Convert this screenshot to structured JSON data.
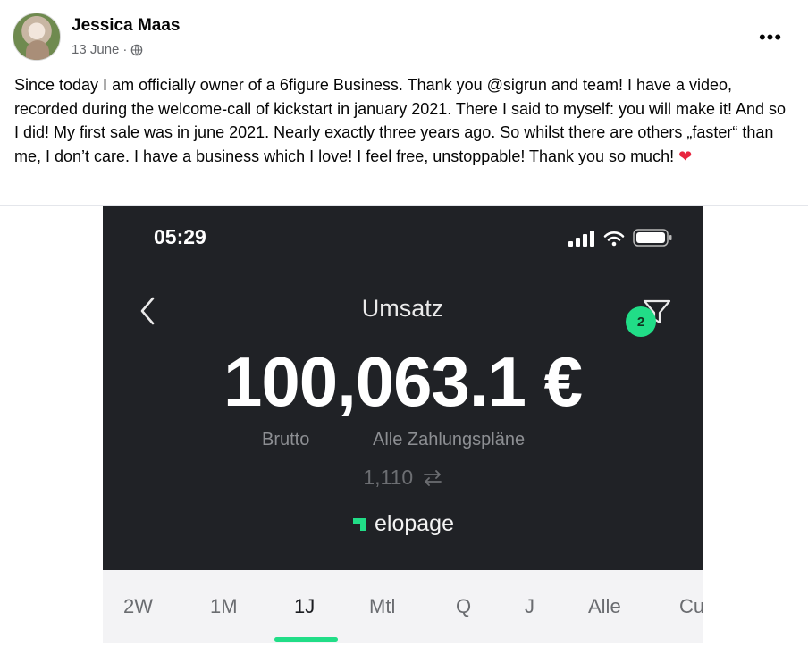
{
  "post": {
    "author": "Jessica Maas",
    "date": "13 June",
    "separator": "·",
    "audience_icon": "globe-icon",
    "more_icon": "more-horizontal-icon",
    "more_label": "•••",
    "text": "Since today I am officially owner of a 6figure Business. Thank you @sigrun and team! I have a video, recorded during the welcome-call of kickstart in january 2021. There I said to myself: you will make it! And so I did! My first sale was in june 2021. Nearly exactly three years ago. So whilst there are others „faster“ than me, I don’t care. I have a business which I love! I feel free, unstoppable! Thank you so much!",
    "emoji": "❤"
  },
  "screenshot": {
    "status_time": "05:29",
    "title": "Umsatz",
    "filter_badge": "2",
    "amount": "100,063.1 €",
    "gross_label": "Brutto",
    "plans_label": "Alle Zahlungspläne",
    "count": "1,110",
    "count_icon": "swap-arrows-icon",
    "brand": "elopage",
    "tabs": [
      {
        "label": "2W",
        "active": false
      },
      {
        "label": "1M",
        "active": false
      },
      {
        "label": "1J",
        "active": true
      },
      {
        "label": "Mtl",
        "active": false
      },
      {
        "label": "Q",
        "active": false
      },
      {
        "label": "J",
        "active": false
      },
      {
        "label": "Alle",
        "active": false
      },
      {
        "label": "Cu",
        "active": false
      }
    ]
  },
  "colors": {
    "panel_bg": "#202226",
    "accent_green": "#21dd87",
    "heart_red": "#e8263f",
    "muted_text": "#65676b"
  }
}
